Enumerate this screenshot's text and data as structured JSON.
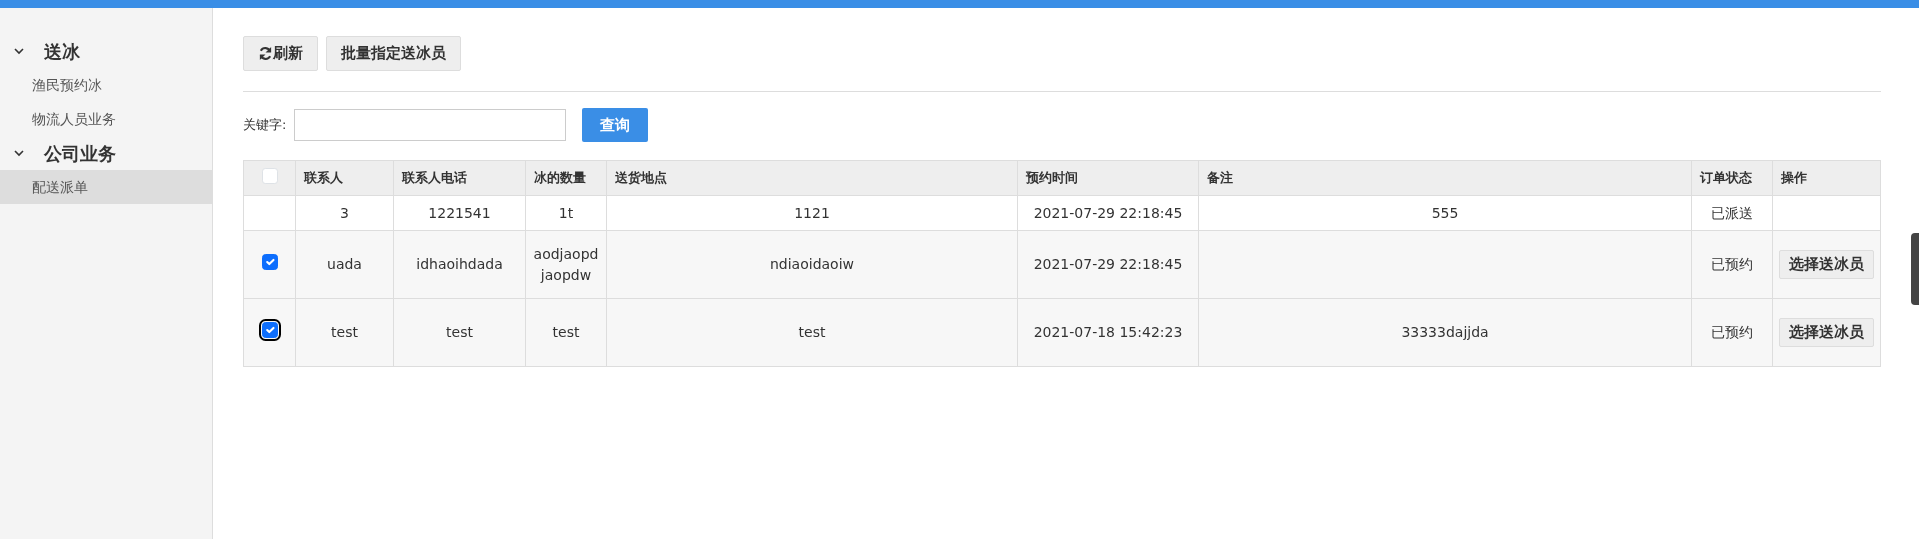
{
  "sidebar": {
    "groups": [
      {
        "label": "送冰",
        "expanded": true,
        "items": [
          {
            "label": "渔民预约冰",
            "selected": false
          },
          {
            "label": "物流人员业务",
            "selected": false
          }
        ]
      },
      {
        "label": "公司业务",
        "expanded": true,
        "items": [
          {
            "label": "配送派单",
            "selected": true
          }
        ]
      }
    ]
  },
  "toolbar": {
    "buttons": [
      {
        "label": "刷新",
        "kind": "refresh"
      },
      {
        "label": "批量指定送冰员",
        "kind": "plain"
      }
    ]
  },
  "search": {
    "label": "关键字:",
    "button": "查询"
  },
  "table": {
    "select_all": {
      "checked": false
    },
    "columns": [
      "联系人",
      "联系人电话",
      "冰的数量",
      "送货地点",
      "预约时间",
      "备注",
      "订单状态",
      "操作"
    ],
    "rows": [
      {
        "checkbox": null,
        "cells": [
          "3",
          "1221541",
          "1t",
          "1121",
          "2021-07-29 22:18:45",
          "555",
          "已派送"
        ],
        "action": null
      },
      {
        "checkbox": {
          "checked": true,
          "focused": false
        },
        "cells": [
          "uada",
          "idhaoihdada",
          "aodjaopd jaopdw",
          "ndiaoidaoiw",
          "2021-07-29 22:18:45",
          "",
          "已预约"
        ],
        "action": "选择送冰员"
      },
      {
        "checkbox": {
          "checked": true,
          "focused": true
        },
        "cells": [
          "test",
          "test",
          "test",
          "test",
          "2021-07-18 15:42:23",
          "33333dajjda",
          "已预约"
        ],
        "action": "选择送冰员"
      }
    ]
  }
}
